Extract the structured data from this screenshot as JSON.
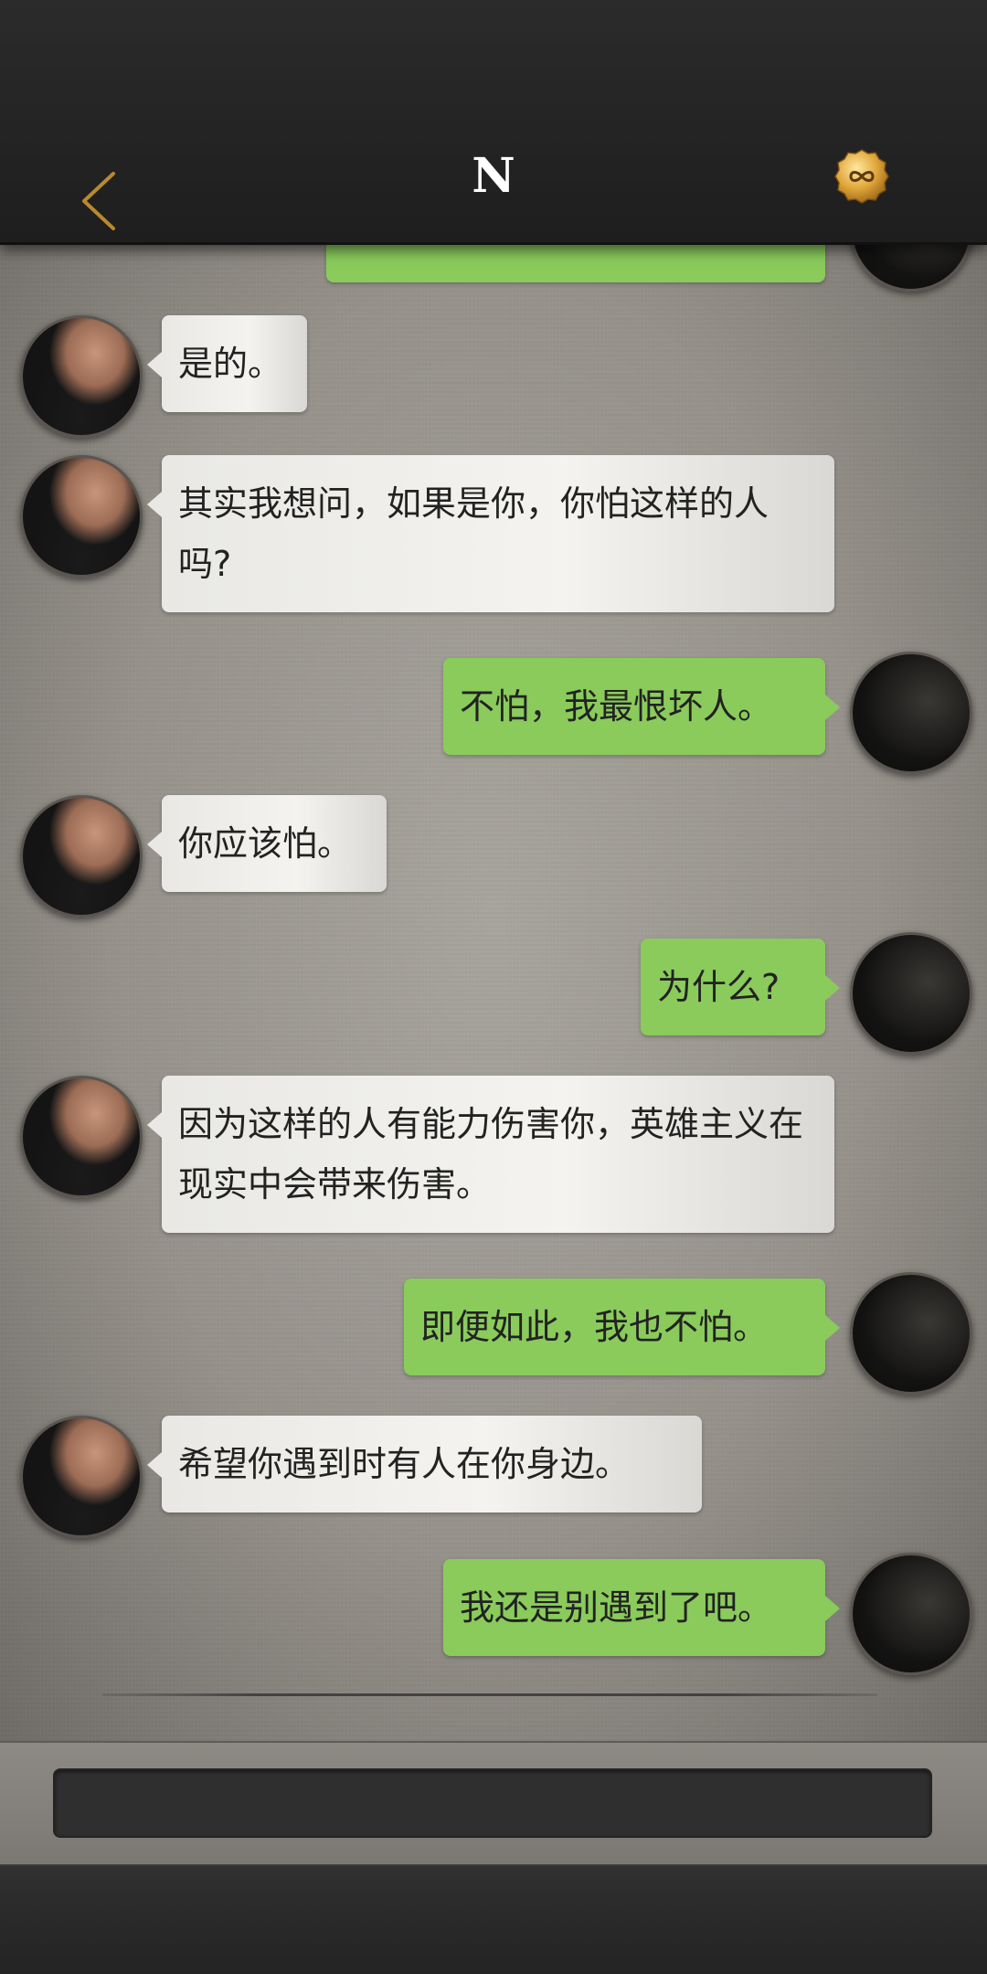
{
  "header": {
    "title": "N",
    "back_icon": "chevron-left-icon",
    "coin_icon": "infinity-coin-icon",
    "accent_color": "#b8892f"
  },
  "messages": [
    {
      "sender": "me",
      "text": ""
    },
    {
      "sender": "friend",
      "text": "是的。"
    },
    {
      "sender": "friend",
      "text": "其实我想问，如果是你，你怕这样的人吗?"
    },
    {
      "sender": "me",
      "text": "不怕，我最恨坏人。"
    },
    {
      "sender": "friend",
      "text": "你应该怕。"
    },
    {
      "sender": "me",
      "text": "为什么?"
    },
    {
      "sender": "friend",
      "text": "因为这样的人有能力伤害你，英雄主义在现实中会带来伤害。"
    },
    {
      "sender": "me",
      "text": "即便如此，我也不怕。"
    },
    {
      "sender": "friend",
      "text": "希望你遇到时有人在你身边。"
    },
    {
      "sender": "me",
      "text": "我还是别遇到了吧。"
    }
  ],
  "input": {
    "value": ""
  },
  "colors": {
    "my_bubble": "#8acb5c",
    "friend_bubble": "#ecebe7"
  }
}
